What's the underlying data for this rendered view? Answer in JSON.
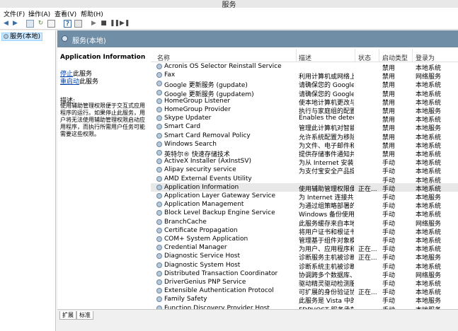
{
  "window": {
    "title": "服务"
  },
  "menu": [
    "文件(F)",
    "操作(A)",
    "查看(V)",
    "帮助(H)"
  ],
  "tree": {
    "root_label": "服务(本地)"
  },
  "header": {
    "title": "服务(本地)"
  },
  "detail": {
    "title": "Application Information",
    "stop_link": "停止",
    "stop_suffix": "此服务",
    "restart_link": "重启动",
    "restart_suffix": "此服务",
    "desc_label": "描述:",
    "desc_text": "使用辅助管理权限便于交互式应用程序的运行。如果停止此服务，用户将无法使用辅助管理权限启动应用程序，而执行所需用户任务可能需要这些权限。"
  },
  "columns": [
    "名称",
    "描述",
    "状态",
    "启动类型",
    "登录为"
  ],
  "services": [
    [
      "Acronis OS Selector Reinstall Service",
      "",
      "",
      "禁用",
      "本地系统"
    ],
    [
      "Fax",
      "利用计算机或网络上...",
      "",
      "禁用",
      "网络服务"
    ],
    [
      "Google 更新服务 (gupdate)",
      "请确保您的 Google...",
      "",
      "禁用",
      "本地系统"
    ],
    [
      "Google 更新服务 (gupdatem)",
      "请确保您的 Google...",
      "",
      "禁用",
      "本地系统"
    ],
    [
      "HomeGroup Listener",
      "使本地计算机更改与...",
      "",
      "禁用",
      "本地系统"
    ],
    [
      "HomeGroup Provider",
      "执行与家庭组的配置...",
      "",
      "禁用",
      "本地服务"
    ],
    [
      "Skype Updater",
      "Enables the detect...",
      "",
      "禁用",
      "本地系统"
    ],
    [
      "Smart Card",
      "管理此计算机对智能...",
      "",
      "禁用",
      "本地服务"
    ],
    [
      "Smart Card Removal Policy",
      "允许系统配置为移除...",
      "",
      "禁用",
      "本地系统"
    ],
    [
      "Windows Search",
      "为文件、电子邮件和...",
      "",
      "禁用",
      "本地系统"
    ],
    [
      "英特尔® 快速存储技术",
      "提供存储事件通知并...",
      "",
      "禁用",
      "本地系统"
    ],
    [
      "ActiveX Installer (AxInstSV)",
      "为从 Internet 安装...",
      "",
      "手动",
      "本地系统"
    ],
    [
      "Alipay security service",
      "为支付宝安全产品提...",
      "",
      "手动",
      "本地系统"
    ],
    [
      "AMD External Events Utility",
      "",
      "",
      "手动",
      "本地系统"
    ],
    [
      "Application Information",
      "使用辅助管理权限便...",
      "正在...",
      "手动",
      "本地系统"
    ],
    [
      "Application Layer Gateway Service",
      "为 Internet 连接共...",
      "",
      "手动",
      "本地服务"
    ],
    [
      "Application Management",
      "为通过组策略部署的...",
      "",
      "手动",
      "本地系统"
    ],
    [
      "Block Level Backup Engine Service",
      "Windows 备份使用...",
      "",
      "手动",
      "本地系统"
    ],
    [
      "BranchCache",
      "此服务缓存来自本地...",
      "",
      "手动",
      "网络服务"
    ],
    [
      "Certificate Propagation",
      "将用户证书和根证书...",
      "",
      "手动",
      "本地系统"
    ],
    [
      "COM+ System Application",
      "管理基于组件对象模...",
      "",
      "手动",
      "本地系统"
    ],
    [
      "Credential Manager",
      "为用户、应用程序和...",
      "正在...",
      "手动",
      "本地系统"
    ],
    [
      "Diagnostic Service Host",
      "诊断服务主机被诊断...",
      "正在...",
      "手动",
      "本地服务"
    ],
    [
      "Diagnostic System Host",
      "诊断系统主机被诊断...",
      "",
      "手动",
      "本地系统"
    ],
    [
      "Distributed Transaction Coordinator",
      "协调跨多个数据库、...",
      "",
      "手动",
      "网络服务"
    ],
    [
      "DriverGenius PNP Service",
      "驱动精灵驱动检测服...",
      "",
      "手动",
      "本地系统"
    ],
    [
      "Extensible Authentication Protocol",
      "可扩展的身份验证协...",
      "正在...",
      "手动",
      "本地系统"
    ],
    [
      "Family Safety",
      "此服务是 Vista 中的...",
      "",
      "手动",
      "本地服务"
    ],
    [
      "Function Discovery Provider Host",
      "FDPHOST 服务承载...",
      "",
      "手动",
      "本地服务"
    ]
  ],
  "selected_index": 14,
  "tabs": [
    "扩展",
    "标准"
  ]
}
